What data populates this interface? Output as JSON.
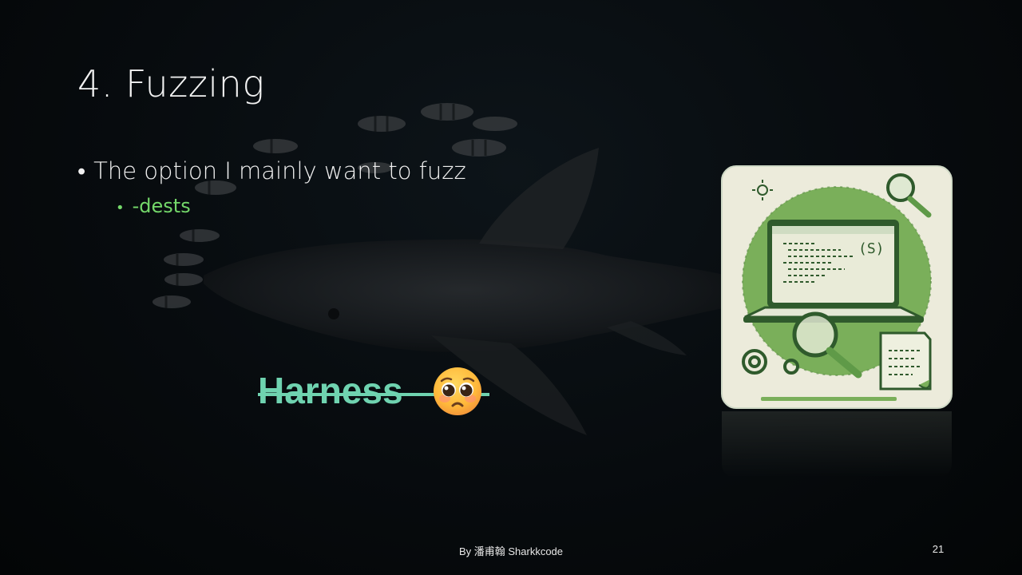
{
  "slide": {
    "title": "4. Fuzzing",
    "bullets": [
      {
        "text": "The option I mainly want to fuzz",
        "level": 1
      },
      {
        "text": "-dests",
        "level": 2
      }
    ],
    "harness_text": "Harness",
    "emoji_name": "pleading-face-emoji",
    "footer": "By 潘甫翰 Sharkkcode",
    "page_number": "21",
    "accent_color": "#74d86a",
    "harness_color": "#6fd3b0",
    "illustration_icons": [
      "laptop-icon",
      "magnifier-icon",
      "gear-icon",
      "document-icon",
      "sun-icon"
    ],
    "code_badge": "(S)"
  }
}
